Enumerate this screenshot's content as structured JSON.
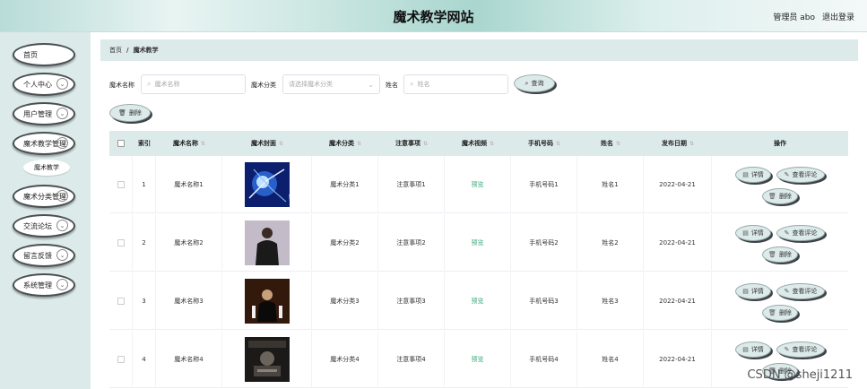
{
  "header": {
    "title": "魔术教学网站",
    "admin": "管理员 abo",
    "logout": "退出登录"
  },
  "sidebar": {
    "items": [
      {
        "label": "首页",
        "chevron": false
      },
      {
        "label": "个人中心",
        "chevron": true
      },
      {
        "label": "用户管理",
        "chevron": true
      },
      {
        "label": "魔术教学管理",
        "chevron": true
      },
      {
        "label": "魔术分类管理",
        "chevron": true
      },
      {
        "label": "交流论坛",
        "chevron": true
      },
      {
        "label": "留言反馈",
        "chevron": true
      },
      {
        "label": "系统管理",
        "chevron": true
      }
    ],
    "sub_item": "魔术教学"
  },
  "breadcrumb": {
    "home": "首页",
    "separator": "/",
    "current": "魔术教学"
  },
  "search": {
    "name_label": "魔术名称",
    "name_placeholder": "魔术名称",
    "category_label": "魔术分类",
    "category_placeholder": "请选择魔术分类",
    "person_label": "姓名",
    "person_placeholder": "姓名",
    "search_button": "查询",
    "delete_button": "删除"
  },
  "table": {
    "headers": {
      "index": "索引",
      "name": "魔术名称",
      "cover": "魔术封面",
      "category": "魔术分类",
      "notes": "注意事项",
      "video": "魔术视频",
      "phone": "手机号码",
      "person": "姓名",
      "date": "发布日期",
      "actions": "操作"
    },
    "rows": [
      {
        "index": "1",
        "name": "魔术名称1",
        "category": "魔术分类1",
        "notes": "注意事项1",
        "video": "预览",
        "phone": "手机号码1",
        "person": "姓名1",
        "date": "2022-04-21"
      },
      {
        "index": "2",
        "name": "魔术名称2",
        "category": "魔术分类2",
        "notes": "注意事项2",
        "video": "预览",
        "phone": "手机号码2",
        "person": "姓名2",
        "date": "2022-04-21"
      },
      {
        "index": "3",
        "name": "魔术名称3",
        "category": "魔术分类3",
        "notes": "注意事项3",
        "video": "预览",
        "phone": "手机号码3",
        "person": "姓名3",
        "date": "2022-04-21"
      },
      {
        "index": "4",
        "name": "魔术名称4",
        "category": "魔术分类4",
        "notes": "注意事项4",
        "video": "预览",
        "phone": "手机号码4",
        "person": "姓名4",
        "date": "2022-04-21"
      }
    ],
    "actions": {
      "detail": "详情",
      "comments": "查看评论",
      "delete": "删除"
    }
  },
  "watermark": "CSDN @sheji1211"
}
